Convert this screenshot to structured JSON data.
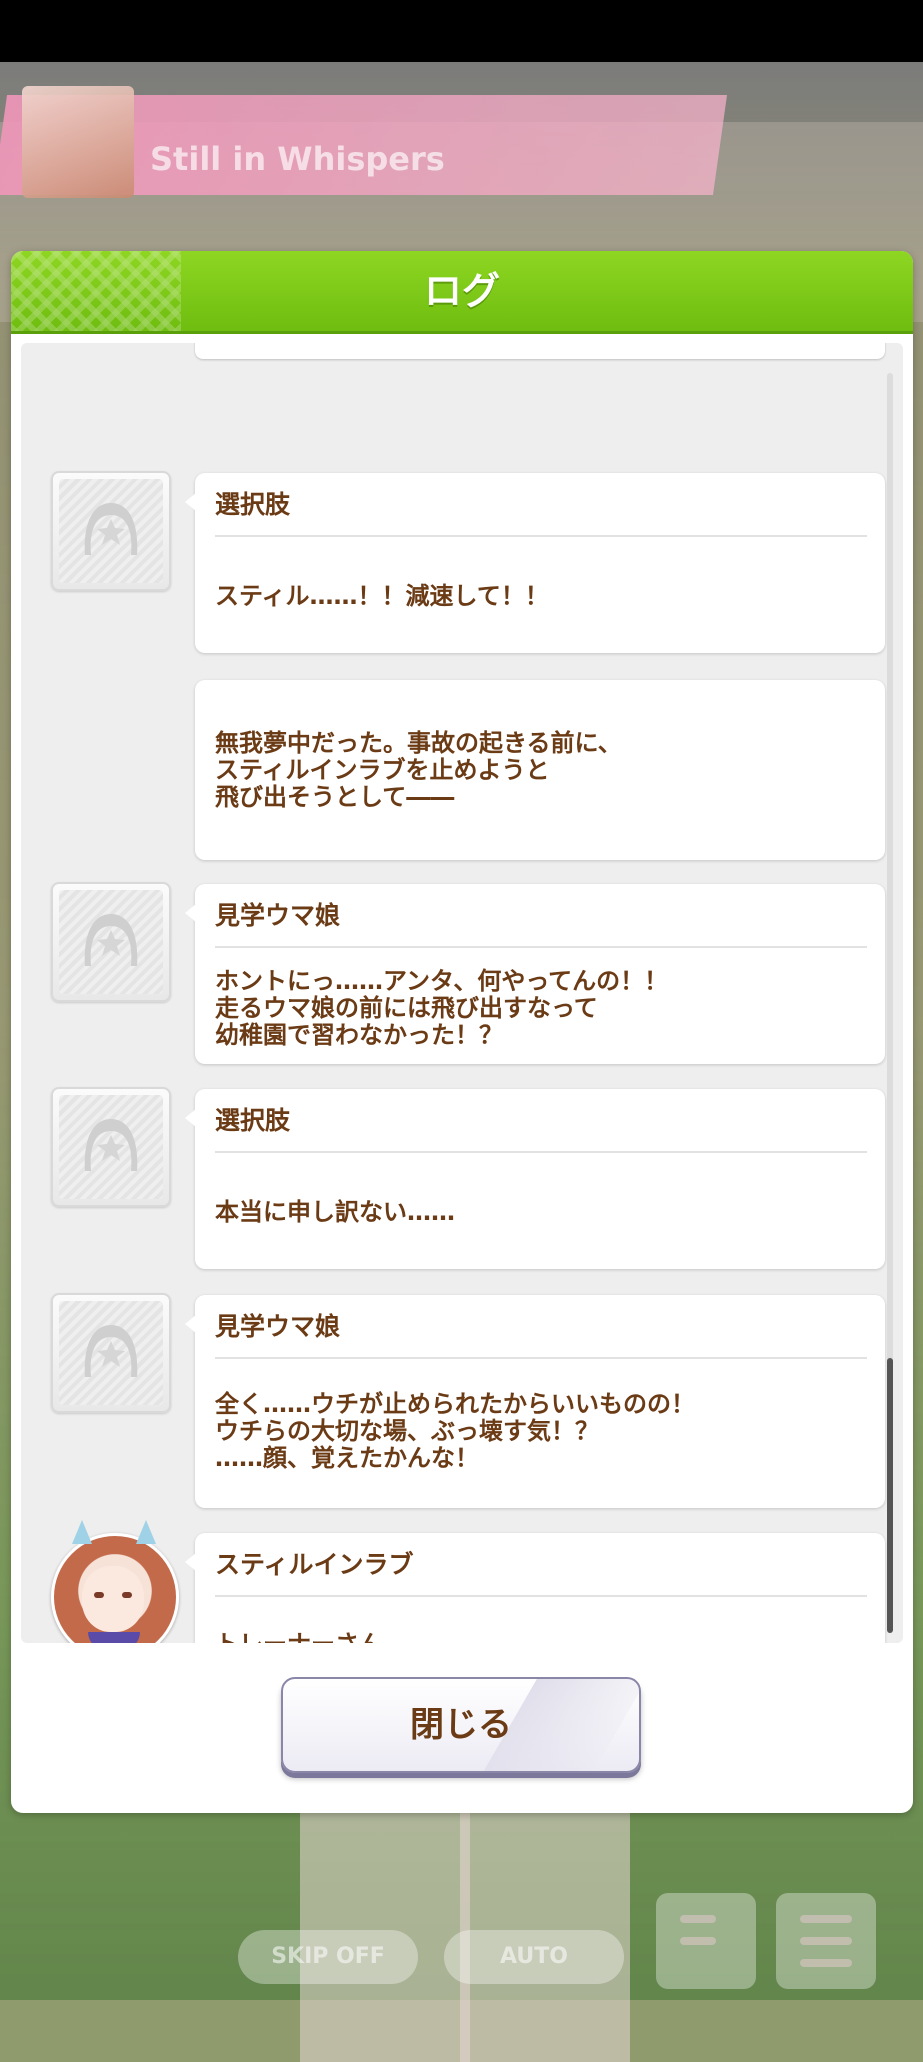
{
  "banner": {
    "subtitle": "Still in Whispers"
  },
  "dialog": {
    "title": "ログ",
    "close_label": "閉じる"
  },
  "log": [
    {
      "speaker": "選択肢",
      "text": "スティル……！！減速して！！",
      "avatar": "horseshoe-icon"
    },
    {
      "speaker": "",
      "text": "無我夢中だった。事故の起きる前に、\nスティルインラブを止めようと\n飛び出そうとして――",
      "avatar": ""
    },
    {
      "speaker": "見学ウマ娘",
      "text": "ホントにっ……アンタ、何やってんの！！\n走るウマ娘の前には飛び出すなって\n幼稚園で習わなかった！？",
      "avatar": "horseshoe-icon"
    },
    {
      "speaker": "選択肢",
      "text": "本当に申し訳ない……",
      "avatar": "horseshoe-icon"
    },
    {
      "speaker": "見学ウマ娘",
      "text": "全く……ウチが止められたからいいものの！\nウチらの大切な場、ぶっ壊す気！？\n……顔、覚えたかんな！",
      "avatar": "horseshoe-icon"
    },
    {
      "speaker": "スティルインラブ",
      "text": "トレーナーさん……\n申し訳ございません、私のせいで……。",
      "avatar": "character-portrait"
    }
  ],
  "controls": {
    "skip_label": "SKIP OFF",
    "auto_label": "AUTO"
  },
  "colors": {
    "header_green": "#7fcb16",
    "text_brown": "#6b3b16",
    "banner_pink": "#f096b9"
  }
}
